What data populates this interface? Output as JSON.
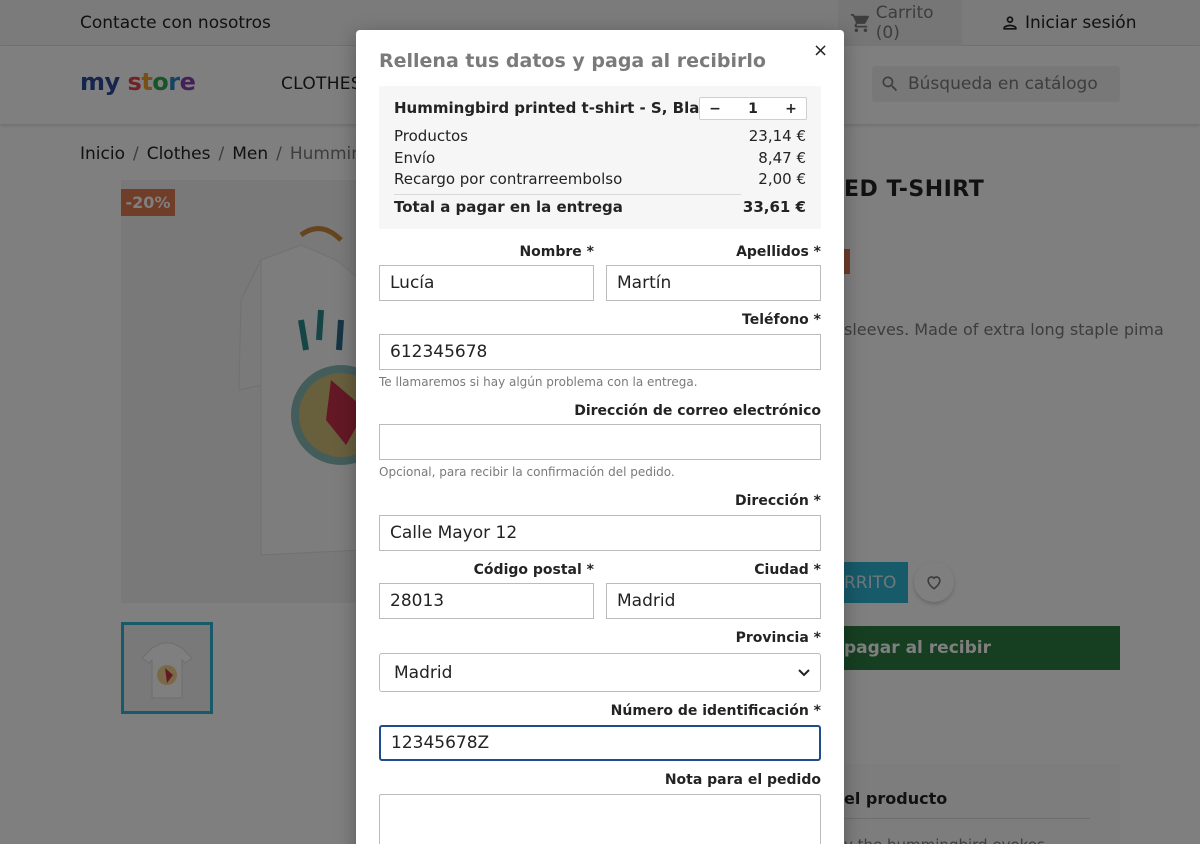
{
  "topbar": {
    "contact": "Contacte con nosotros",
    "cart_label": "Carrito (0)",
    "login": "Iniciar sesión"
  },
  "header": {
    "logo": "my store",
    "nav_clothes": "CLOTHES",
    "search_placeholder": "Búsqueda en catálogo"
  },
  "breadcrumb": [
    "Inicio",
    "Clothes",
    "Men",
    "Hummingbird"
  ],
  "product": {
    "discount_badge": "-20%",
    "title_visible": "ED T-SHIRT",
    "desc_visible": "sleeves. Made of extra long staple pima",
    "add_to_cart_visible": "RRITO",
    "cod_button_visible": "pagar al recibir",
    "details_visible": "el producto",
    "bottom_text_visible": "y the hummingbird evokes"
  },
  "modal": {
    "title": "Rellena tus datos y paga al recibirlo",
    "close": "×",
    "summary": {
      "product": "Hummingbird printed t-shirt - S, Blanco",
      "qty_minus": "−",
      "qty_value": "1",
      "qty_plus": "+",
      "rows": [
        {
          "label": "Productos",
          "value": "23,14 €"
        },
        {
          "label": "Envío",
          "value": "8,47 €"
        },
        {
          "label": "Recargo por contrarreembolso",
          "value": "2,00 €"
        }
      ],
      "total_label": "Total a pagar en la entrega",
      "total_value": "33,61 €"
    },
    "fields": {
      "nombre_label": "Nombre *",
      "nombre_value": "Lucía",
      "apellidos_label": "Apellidos *",
      "apellidos_value": "Martín",
      "telefono_label": "Teléfono *",
      "telefono_value": "612345678",
      "telefono_help": "Te llamaremos si hay algún problema con la entrega.",
      "email_label": "Dirección de correo electrónico",
      "email_value": "",
      "email_help": "Opcional, para recibir la confirmación del pedido.",
      "direccion_label": "Dirección *",
      "direccion_value": "Calle Mayor 12",
      "cp_label": "Código postal *",
      "cp_value": "28013",
      "ciudad_label": "Ciudad *",
      "ciudad_value": "Madrid",
      "provincia_label": "Provincia *",
      "provincia_value": "Madrid",
      "id_label": "Número de identificación *",
      "id_value": "12345678Z",
      "nota_label": "Nota para el pedido",
      "nota_value": ""
    }
  },
  "colors": {
    "accent": "#2fb5d2",
    "discount": "#e07b53",
    "cod_green": "#2c7e44",
    "focus_border": "#1f4d8c"
  }
}
